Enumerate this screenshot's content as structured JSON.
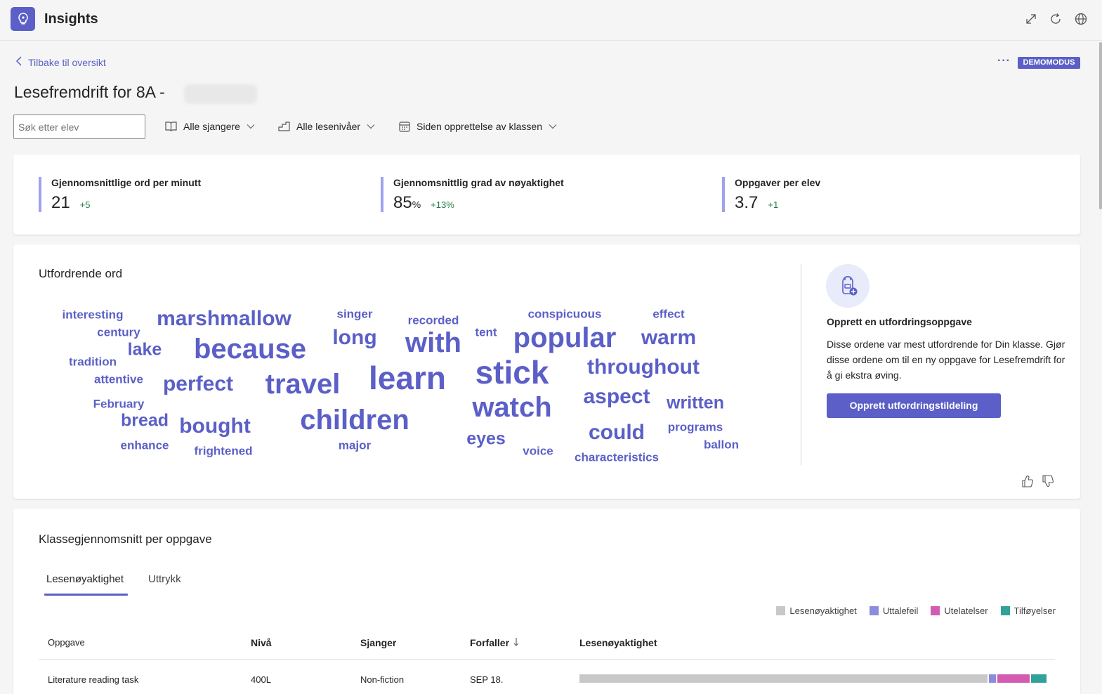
{
  "app": {
    "title": "Insights",
    "icon": "lightbulb-icon"
  },
  "top_icons": [
    "expand-icon",
    "refresh-icon",
    "globe-icon"
  ],
  "header": {
    "back_label": "Tilbake til oversikt",
    "more_label": "···",
    "badge": "DEMOMODUS",
    "title": "Lesefremdrift for 8A -"
  },
  "filters": {
    "search_placeholder": "Søk etter elev",
    "genre": "Alle sjangere",
    "level": "Alle lesenivåer",
    "period": "Siden opprettelse av klassen"
  },
  "stats": [
    {
      "label": "Gjennomsnittlige ord per minutt",
      "value": "21",
      "unit": "",
      "delta": "+5"
    },
    {
      "label": "Gjennomsnittlig grad av nøyaktighet",
      "value": "85",
      "unit": "%",
      "delta": "+13%"
    },
    {
      "label": "Oppgaver per elev",
      "value": "3.7",
      "unit": "",
      "delta": "+1"
    }
  ],
  "challenging_words": {
    "title": "Utfordrende ord",
    "words": [
      {
        "text": "interesting",
        "weight": 1
      },
      {
        "text": "century",
        "weight": 1
      },
      {
        "text": "tradition",
        "weight": 1
      },
      {
        "text": "attentive",
        "weight": 1
      },
      {
        "text": "February",
        "weight": 1
      },
      {
        "text": "marshmallow",
        "weight": 3
      },
      {
        "text": "lake",
        "weight": 2
      },
      {
        "text": "because",
        "weight": 4
      },
      {
        "text": "perfect",
        "weight": 3
      },
      {
        "text": "bread",
        "weight": 2
      },
      {
        "text": "enhance",
        "weight": 1
      },
      {
        "text": "bought",
        "weight": 3
      },
      {
        "text": "frightened",
        "weight": 1
      },
      {
        "text": "travel",
        "weight": 4
      },
      {
        "text": "singer",
        "weight": 1
      },
      {
        "text": "long",
        "weight": 3
      },
      {
        "text": "learn",
        "weight": 5
      },
      {
        "text": "children",
        "weight": 4
      },
      {
        "text": "major",
        "weight": 1
      },
      {
        "text": "recorded",
        "weight": 1
      },
      {
        "text": "with",
        "weight": 4
      },
      {
        "text": "tent",
        "weight": 1
      },
      {
        "text": "stick",
        "weight": 5
      },
      {
        "text": "watch",
        "weight": 4
      },
      {
        "text": "eyes",
        "weight": 2
      },
      {
        "text": "voice",
        "weight": 1
      },
      {
        "text": "conspicuous",
        "weight": 1
      },
      {
        "text": "popular",
        "weight": 4
      },
      {
        "text": "aspect",
        "weight": 3
      },
      {
        "text": "could",
        "weight": 3
      },
      {
        "text": "characteristics",
        "weight": 1
      },
      {
        "text": "effect",
        "weight": 1
      },
      {
        "text": "warm",
        "weight": 3
      },
      {
        "text": "throughout",
        "weight": 3
      },
      {
        "text": "written",
        "weight": 2
      },
      {
        "text": "programs",
        "weight": 1
      },
      {
        "text": "ballon",
        "weight": 1
      }
    ],
    "panel": {
      "icon": "backpack-add-icon",
      "title": "Opprett en utfordringsoppgave",
      "text": "Disse ordene var mest utfordrende for Din klasse. Gjør disse ordene om til en ny oppgave for Lesefremdrift for å gi ekstra øving.",
      "button": "Opprett utfordringstildeling"
    },
    "feedback": [
      "thumbs-up-icon",
      "thumbs-down-icon"
    ]
  },
  "class_average": {
    "title": "Klassegjennomsnitt per oppgave",
    "tabs": [
      "Lesenøyaktighet",
      "Uttrykk"
    ],
    "active_tab": 0,
    "legend": [
      {
        "label": "Lesenøyaktighet",
        "color": "#c8c8c8"
      },
      {
        "label": "Uttalefeil",
        "color": "#8b8cdb"
      },
      {
        "label": "Utelatelser",
        "color": "#d35cb1"
      },
      {
        "label": "Tilføyelser",
        "color": "#30a299"
      }
    ],
    "columns": [
      "Oppgave",
      "Nivå",
      "Sjanger",
      "Forfaller",
      "Lesenøyaktighet"
    ],
    "sort_icon": "arrow-down-icon",
    "rows": [
      {
        "task": "Literature reading task",
        "level": "400L",
        "genre": "Non-fiction",
        "due": "SEP 18.",
        "breakdown": {
          "accuracy": 0.8768,
          "mispronunciation": 0.0182,
          "omissions": 0.0712,
          "insertions": 0.0338
        }
      }
    ]
  }
}
